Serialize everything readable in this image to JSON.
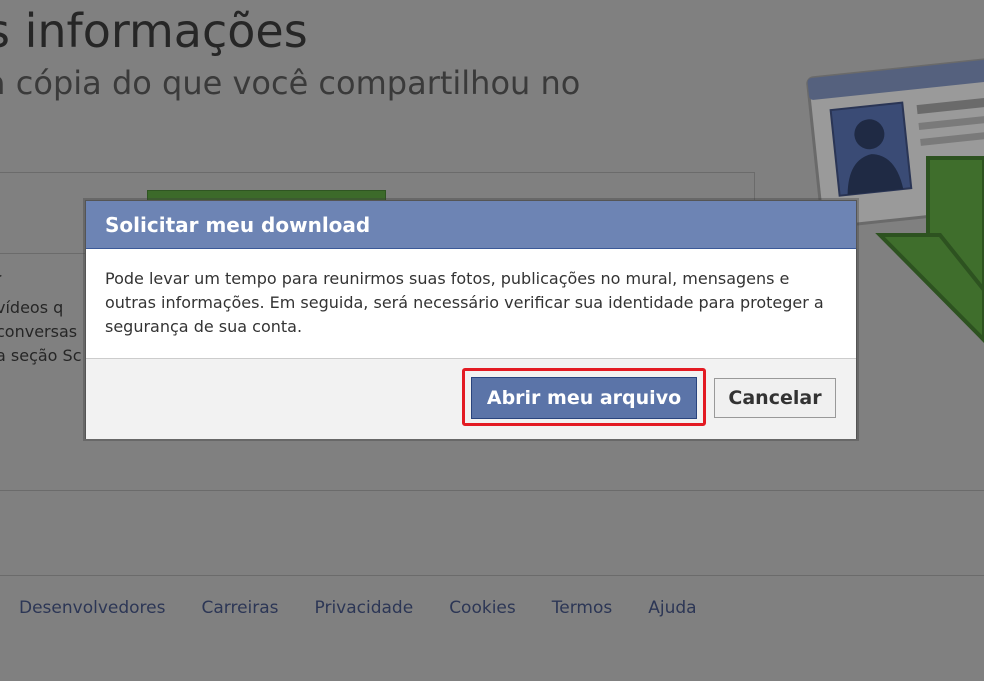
{
  "page": {
    "title": "s informações",
    "subtitle": "a cópia do que você compartilhou no",
    "left_text": [
      "vídeos q",
      "conversas",
      "a seção Sc"
    ],
    "left_mark": "▸"
  },
  "dialog": {
    "title": "Solicitar meu download",
    "body": "Pode levar um tempo para reunirmos suas fotos, publicações no mural, mensagens e outras informações. Em seguida, será necessário verificar sua identidade para proteger a segurança de sua conta.",
    "primary_button": "Abrir meu arquivo",
    "cancel_button": "Cancelar"
  },
  "footer": {
    "links": [
      "Desenvolvedores",
      "Carreiras",
      "Privacidade",
      "Cookies",
      "Termos",
      "Ajuda"
    ]
  },
  "colors": {
    "overlay": "#808080",
    "dialog_header": "#6d84b4",
    "primary_button": "#5b74a8",
    "highlight": "#e31b23",
    "download_arrow": "#3f6e2c"
  },
  "icons": {
    "illustration": "id-card-download-icon"
  }
}
